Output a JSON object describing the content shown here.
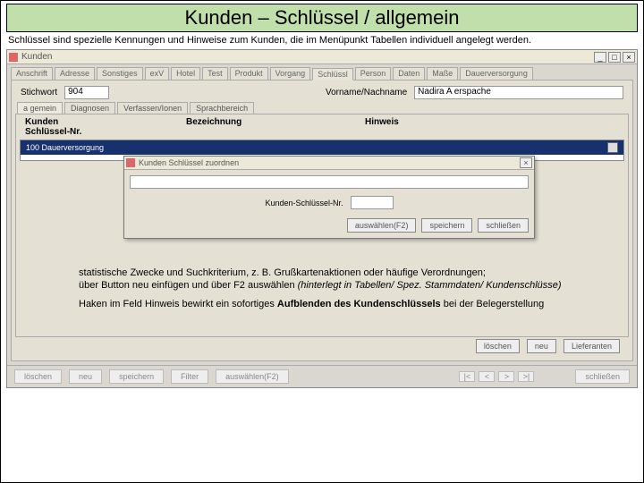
{
  "banner": {
    "title": "Kunden – Schlüssel / allgemein"
  },
  "intro": "Schlüssel sind spezielle Kennungen und Hinweise zum Kunden, die im Menüpunkt Tabellen individuell angelegt werden.",
  "window": {
    "title": "Kunden",
    "minimize": "_",
    "maximize": "□",
    "close": "×"
  },
  "outer_tabs": [
    "Anschrift",
    "Adresse",
    "Sonstiges",
    "exV",
    "Hotel",
    "Test",
    "Produkt",
    "Vorgang",
    "Schlüssl",
    "Person",
    "Daten",
    "Maße",
    "Dauerversorgung"
  ],
  "active_outer_tab": 8,
  "top_row": {
    "label1": "Stichwort",
    "value1": "904",
    "label2": "Vorname/Nachname",
    "value2": "Nadira A erspache"
  },
  "inner_tabs": [
    "a gemein",
    "Diagnosen",
    "Verfassen/Ionen",
    "Sprachbereich"
  ],
  "active_inner_tab": 0,
  "columns": {
    "c1": "Kunden\nSchlüssel-Nr.",
    "c2": "Bezeichnung",
    "c3": "Hinweis"
  },
  "list_row": {
    "text": "100 Dauerversorgung"
  },
  "dialog": {
    "title": "Kunden Schlüssel zuordnen",
    "close": "×",
    "field_label": "Kunden-Schlüssel-Nr.",
    "btn1": "auswählen(F2)",
    "btn2": "speichern",
    "btn3": "schließen"
  },
  "notes": {
    "p1a": "statistische Zwecke und Suchkriterium, z. B. Grußkartenaktionen oder häufige Verordnungen;",
    "p1b_pre": "über Button neu einfügen und über F2 auswählen ",
    "p1b_ital": "(hinterlegt in Tabellen/ Spez. Stammdaten/ Kundenschlüsse)",
    "p2a": "Haken im Feld Hinweis bewirkt ein sofortiges ",
    "p2b_bold": "Aufblenden des Kundenschlüssels",
    "p2c": " bei der Belegerstellung"
  },
  "bottom_buttons": {
    "b1": "löschen",
    "b2": "neu",
    "b3": "Lieferanten"
  },
  "footer": {
    "f1": "löschen",
    "f2": "neu",
    "f3": "speichern",
    "f4": "Filter",
    "f5": "auswählen(F2)",
    "nav": [
      "|<",
      "<",
      ">",
      ">|"
    ],
    "close": "schließen"
  }
}
